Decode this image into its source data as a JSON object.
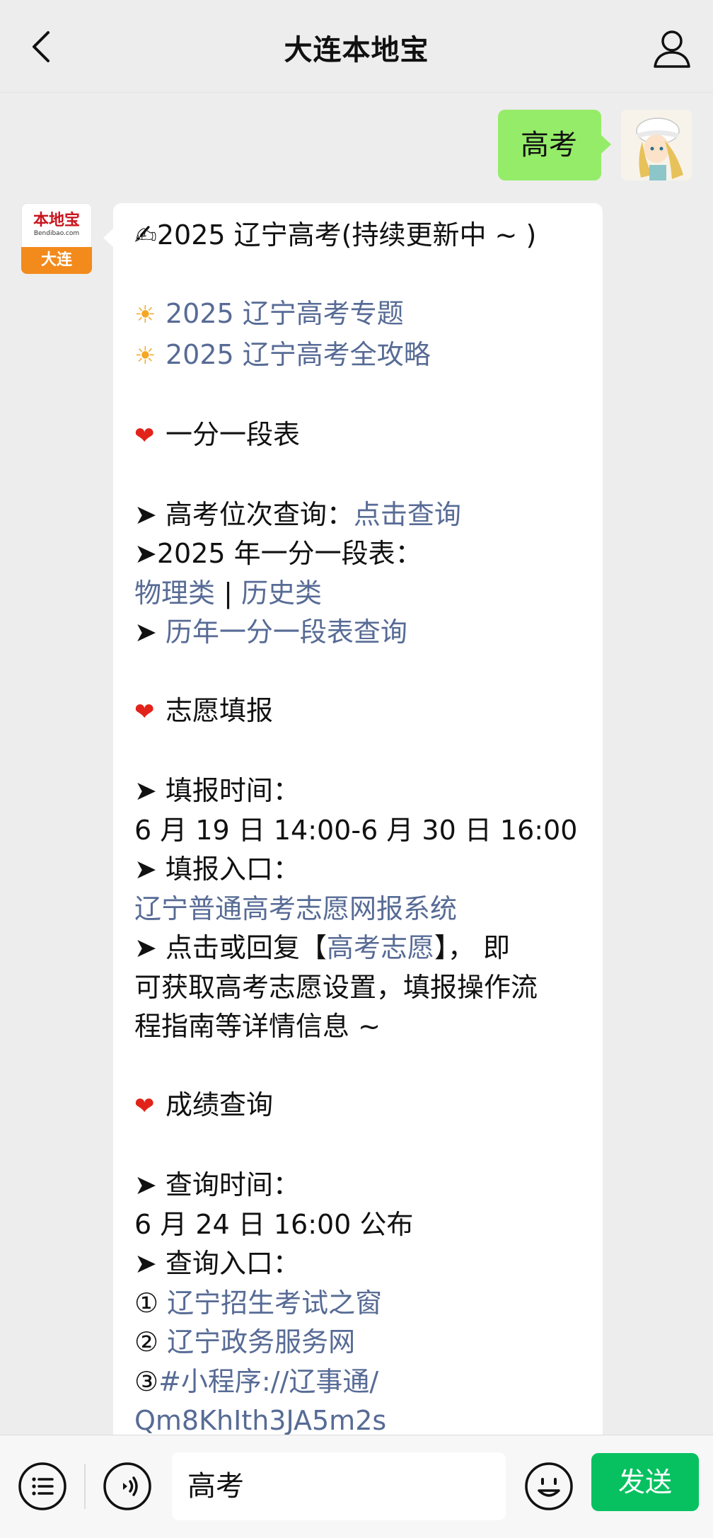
{
  "header": {
    "title": "大连本地宝",
    "back_icon": "chevron-left-icon",
    "profile_icon": "person-icon"
  },
  "user_message": {
    "text": "高考"
  },
  "bot": {
    "avatar": {
      "logo_text": "本地宝",
      "logo_sub": "Bendibao.com",
      "city": "大连"
    },
    "message": {
      "title": "✍2025 辽宁高考(持续更新中 ~ )",
      "link_topic": "2025 辽宁高考专题",
      "link_guide": "2025 辽宁高考全攻略",
      "sec1_title": "一分一段表",
      "rank_label": "➤ 高考位次查询：",
      "rank_link": "点击查询",
      "table_label": "➤2025 年一分一段表：",
      "physics_link": "物理类",
      "sep": " | ",
      "history_link": "历史类",
      "arrow": "➤ ",
      "past_link": "历年一分一段表查询",
      "sec2_title": "志愿填报",
      "fill_time_label": "➤ 填报时间：",
      "fill_time_value": "6 月 19 日 14:00-6 月 30 日 16:00",
      "fill_entry_label": "➤ 填报入口：",
      "fill_entry_link": "辽宁普通高考志愿网报系统",
      "reply_prefix": "➤ 点击或回复【",
      "reply_link": "高考志愿",
      "reply_suffix": "】， 即",
      "reply_line2": "可获取高考志愿设置，填报操作流",
      "reply_line3": "程指南等详情信息 ~",
      "sec3_title": "成绩查询",
      "query_time_label": "➤ 查询时间：",
      "query_time_value": "6 月 24 日 16:00 公布",
      "query_entry_label": "➤ 查询入口：",
      "n1": "① ",
      "q1_link": "辽宁招生考试之窗",
      "n2": "② ",
      "q2_link": "辽宁政务服务网",
      "n3": "③",
      "q3_link_a": "#小程序://辽事通/",
      "q3_link_b": "Qm8KhIth3JA5m2s"
    }
  },
  "input_bar": {
    "menu_icon": "list-menu-icon",
    "voice_icon": "voice-icon",
    "input_value": "高考",
    "emoji_icon": "emoji-icon",
    "send_label": "发送"
  },
  "colors": {
    "background": "#ededed",
    "user_bubble": "#95ec69",
    "link": "#576b95",
    "send_button": "#07c160",
    "avatar_orange": "#f28a1c"
  }
}
